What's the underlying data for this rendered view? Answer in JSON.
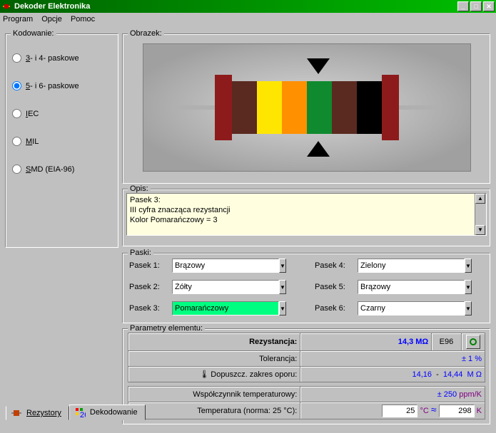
{
  "title": "Dekoder Elektronika",
  "menu": {
    "program": "Program",
    "opcje": "Opcje",
    "pomoc": "Pomoc"
  },
  "groups": {
    "kodowanie": "Kodowanie:",
    "obrazek": "Obrazek:",
    "opis": "Opis:",
    "paski": "Paski:",
    "params": "Parametry elementu:"
  },
  "radios": {
    "r1": "- i 4- paskowe",
    "r2": "- i 6- paskowe",
    "r3": "EC",
    "r4": "IL",
    "r5": "MD (EIA-96)"
  },
  "radios_ul": {
    "r1": "3",
    "r2": "5",
    "r3": "I",
    "r4": "M",
    "r5": "S"
  },
  "opis_lines": {
    "l1": "Pasek 3:",
    "l2": "III cyfra znacząca rezystancji",
    "l3": "Kolor Pomarańczowy = 3"
  },
  "paski": {
    "labels": {
      "p1": "Pasek 1:",
      "p2": "Pasek 2:",
      "p3": "Pasek 3:",
      "p4": "Pasek 4:",
      "p5": "Pasek 5:",
      "p6": "Pasek 6:"
    },
    "values": {
      "p1": "Brązowy",
      "p2": "Żółty",
      "p3": "Pomarańczowy",
      "p4": "Zielony",
      "p5": "Brązowy",
      "p6": "Czarny"
    }
  },
  "params": {
    "labels": {
      "rez": "Rezystancja:",
      "tol": "Tolerancja:",
      "zakres": "Dopuszcz. zakres oporu:",
      "temp_coef": "Współczynnik temperaturowy:",
      "temp": "Temperatura (norma: 25 °C):"
    },
    "values": {
      "rez": "14,3",
      "rez_unit": "MΩ",
      "e96": "E96",
      "tol": "± 1",
      "tol_unit": "%",
      "zmin": "14,16",
      "zmax": "14,44",
      "zunit": "M Ω",
      "coef": "± 250",
      "coef_unit": "ppm/K",
      "temp_c": "25",
      "temp_c_unit": "°C",
      "temp_k": "298",
      "temp_k_unit": "K"
    }
  },
  "bands": {
    "endcap": "#8e1b1b",
    "core": "#8e1b1b",
    "c1": "#5a2a20",
    "c2": "#ffe600",
    "c3": "#ff9000",
    "c4": "#0f8a2f",
    "c5": "#5a2a20",
    "c6": "#000000"
  },
  "tabs": {
    "t1": "Rezystory",
    "t2": "Dekodowanie"
  }
}
